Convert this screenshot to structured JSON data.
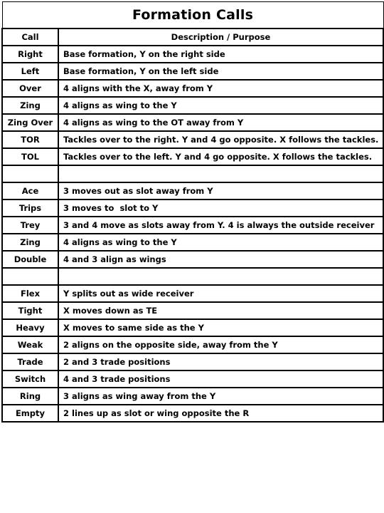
{
  "document": {
    "title": "Formation Calls"
  },
  "table": {
    "columns": [
      {
        "key": "call",
        "label": "Call"
      },
      {
        "key": "description",
        "label": "Description / Purpose"
      }
    ],
    "rows": [
      {
        "type": "data",
        "call": "Right",
        "description": "Base formation, Y on the right side"
      },
      {
        "type": "data",
        "call": "Left",
        "description": "Base formation, Y on the left side"
      },
      {
        "type": "data",
        "call": "Over",
        "description": "4 aligns with the X, away from Y"
      },
      {
        "type": "data",
        "call": "Zing",
        "description": "4 aligns as wing to the Y"
      },
      {
        "type": "data",
        "call": "Zing Over",
        "description": "4 aligns as wing to the OT away from Y"
      },
      {
        "type": "data",
        "call": "TOR",
        "description": "Tackles over to the right. Y and 4 go opposite. X follows the tackles."
      },
      {
        "type": "data",
        "call": "TOL",
        "description": "Tackles over to the left. Y and 4 go opposite. X follows the tackles."
      },
      {
        "type": "spacer",
        "call": "",
        "description": ""
      },
      {
        "type": "data",
        "call": "Ace",
        "description": "3 moves out as slot away from Y"
      },
      {
        "type": "data",
        "call": "Trips",
        "description": "3 moves to  slot to Y"
      },
      {
        "type": "data",
        "call": "Trey",
        "description": "3 and 4 move as slots away from Y. 4 is always the outside receiver"
      },
      {
        "type": "data",
        "call": "Zing",
        "description": "4 aligns as wing to the Y"
      },
      {
        "type": "data",
        "call": "Double",
        "description": "4 and 3 align as wings"
      },
      {
        "type": "spacer",
        "call": "",
        "description": ""
      },
      {
        "type": "data",
        "call": "Flex",
        "description": "Y splits out as wide receiver"
      },
      {
        "type": "data",
        "call": "Tight",
        "description": "X moves down as TE"
      },
      {
        "type": "data",
        "call": "Heavy",
        "description": "X moves to same side as the Y"
      },
      {
        "type": "data",
        "call": "Weak",
        "description": "2 aligns on the opposite side, away from the Y"
      },
      {
        "type": "data",
        "call": "Trade",
        "description": "2 and 3 trade positions"
      },
      {
        "type": "data",
        "call": "Switch",
        "description": "4 and 3 trade positions"
      },
      {
        "type": "data",
        "call": "Ring",
        "description": "3 aligns as wing away from the Y"
      },
      {
        "type": "data",
        "call": "Empty",
        "description": "2 lines up as slot or wing opposite the R"
      }
    ]
  },
  "colors": {
    "border": "#000000",
    "text": "#000000",
    "background": "#ffffff"
  }
}
